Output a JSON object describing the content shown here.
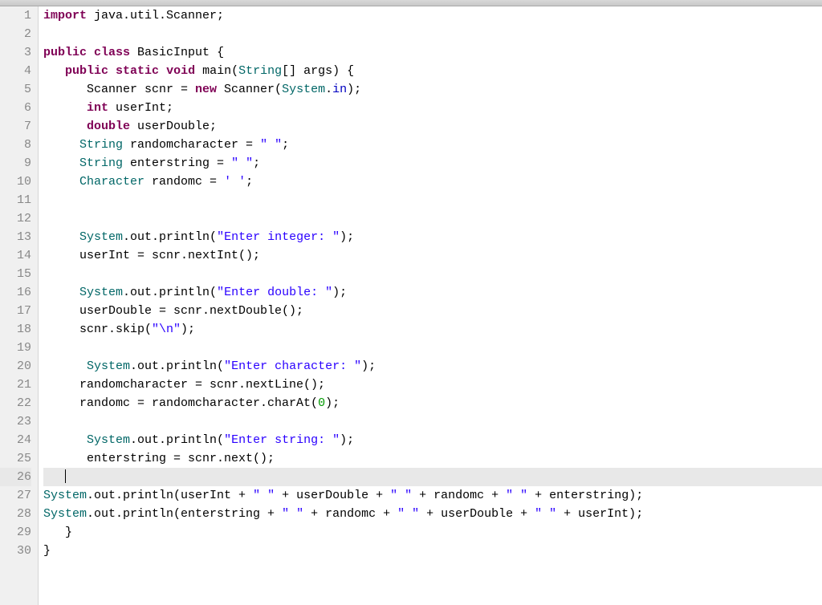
{
  "editor": {
    "current_line": 26,
    "lines": [
      {
        "num": 1,
        "tokens": [
          [
            "kw",
            "import"
          ],
          [
            "plain",
            " java.util.Scanner;"
          ]
        ]
      },
      {
        "num": 2,
        "tokens": [
          [
            "plain",
            ""
          ]
        ]
      },
      {
        "num": 3,
        "tokens": [
          [
            "kw",
            "public"
          ],
          [
            "plain",
            " "
          ],
          [
            "kw",
            "class"
          ],
          [
            "plain",
            " BasicInput {"
          ]
        ]
      },
      {
        "num": 4,
        "tokens": [
          [
            "plain",
            "   "
          ],
          [
            "kw",
            "public"
          ],
          [
            "plain",
            " "
          ],
          [
            "kw",
            "static"
          ],
          [
            "plain",
            " "
          ],
          [
            "kw",
            "void"
          ],
          [
            "plain",
            " main("
          ],
          [
            "type",
            "String"
          ],
          [
            "plain",
            "[] args) {"
          ]
        ]
      },
      {
        "num": 5,
        "tokens": [
          [
            "plain",
            "      Scanner scnr = "
          ],
          [
            "kw",
            "new"
          ],
          [
            "plain",
            " Scanner("
          ],
          [
            "type",
            "System"
          ],
          [
            "plain",
            "."
          ],
          [
            "fld",
            "in"
          ],
          [
            "plain",
            ");"
          ]
        ]
      },
      {
        "num": 6,
        "tokens": [
          [
            "plain",
            "      "
          ],
          [
            "kw",
            "int"
          ],
          [
            "plain",
            " userInt;"
          ]
        ]
      },
      {
        "num": 7,
        "tokens": [
          [
            "plain",
            "      "
          ],
          [
            "kw",
            "double"
          ],
          [
            "plain",
            " userDouble;"
          ]
        ]
      },
      {
        "num": 8,
        "tokens": [
          [
            "plain",
            "     "
          ],
          [
            "type",
            "String"
          ],
          [
            "plain",
            " randomcharacter = "
          ],
          [
            "str",
            "\" \""
          ],
          [
            "plain",
            ";"
          ]
        ]
      },
      {
        "num": 9,
        "tokens": [
          [
            "plain",
            "     "
          ],
          [
            "type",
            "String"
          ],
          [
            "plain",
            " enterstring = "
          ],
          [
            "str",
            "\" \""
          ],
          [
            "plain",
            ";"
          ]
        ]
      },
      {
        "num": 10,
        "tokens": [
          [
            "plain",
            "     "
          ],
          [
            "type",
            "Character"
          ],
          [
            "plain",
            " randomc = "
          ],
          [
            "str",
            "' '"
          ],
          [
            "plain",
            ";"
          ]
        ]
      },
      {
        "num": 11,
        "tokens": [
          [
            "plain",
            ""
          ]
        ]
      },
      {
        "num": 12,
        "tokens": [
          [
            "plain",
            ""
          ]
        ]
      },
      {
        "num": 13,
        "tokens": [
          [
            "plain",
            "     "
          ],
          [
            "type",
            "System"
          ],
          [
            "plain",
            ".out.println("
          ],
          [
            "str",
            "\"Enter integer: \""
          ],
          [
            "plain",
            ");"
          ]
        ]
      },
      {
        "num": 14,
        "tokens": [
          [
            "plain",
            "     userInt = scnr.nextInt();"
          ]
        ]
      },
      {
        "num": 15,
        "tokens": [
          [
            "plain",
            ""
          ]
        ]
      },
      {
        "num": 16,
        "tokens": [
          [
            "plain",
            "     "
          ],
          [
            "type",
            "System"
          ],
          [
            "plain",
            ".out.println("
          ],
          [
            "str",
            "\"Enter double: \""
          ],
          [
            "plain",
            ");"
          ]
        ]
      },
      {
        "num": 17,
        "tokens": [
          [
            "plain",
            "     userDouble = scnr.nextDouble();"
          ]
        ]
      },
      {
        "num": 18,
        "tokens": [
          [
            "plain",
            "     scnr.skip("
          ],
          [
            "str",
            "\"\\n\""
          ],
          [
            "plain",
            ");"
          ]
        ]
      },
      {
        "num": 19,
        "tokens": [
          [
            "plain",
            ""
          ]
        ]
      },
      {
        "num": 20,
        "tokens": [
          [
            "plain",
            "      "
          ],
          [
            "type",
            "System"
          ],
          [
            "plain",
            ".out.println("
          ],
          [
            "str",
            "\"Enter character: \""
          ],
          [
            "plain",
            ");"
          ]
        ]
      },
      {
        "num": 21,
        "tokens": [
          [
            "plain",
            "     randomcharacter = scnr.nextLine();"
          ]
        ]
      },
      {
        "num": 22,
        "tokens": [
          [
            "plain",
            "     randomc = randomcharacter.charAt("
          ],
          [
            "num",
            "0"
          ],
          [
            "plain",
            ");"
          ]
        ]
      },
      {
        "num": 23,
        "tokens": [
          [
            "plain",
            ""
          ]
        ]
      },
      {
        "num": 24,
        "tokens": [
          [
            "plain",
            "      "
          ],
          [
            "type",
            "System"
          ],
          [
            "plain",
            ".out.println("
          ],
          [
            "str",
            "\"Enter string: \""
          ],
          [
            "plain",
            ");"
          ]
        ]
      },
      {
        "num": 25,
        "tokens": [
          [
            "plain",
            "      enterstring = scnr.next();"
          ]
        ]
      },
      {
        "num": 26,
        "tokens": [
          [
            "plain",
            "   "
          ]
        ],
        "current": true
      },
      {
        "num": 27,
        "tokens": [
          [
            "type",
            "System"
          ],
          [
            "plain",
            ".out.println(userInt + "
          ],
          [
            "str",
            "\" \""
          ],
          [
            "plain",
            " + userDouble + "
          ],
          [
            "str",
            "\" \""
          ],
          [
            "plain",
            " + randomc + "
          ],
          [
            "str",
            "\" \""
          ],
          [
            "plain",
            " + enterstring);"
          ]
        ]
      },
      {
        "num": 28,
        "tokens": [
          [
            "type",
            "System"
          ],
          [
            "plain",
            ".out.println(enterstring + "
          ],
          [
            "str",
            "\" \""
          ],
          [
            "plain",
            " + randomc + "
          ],
          [
            "str",
            "\" \""
          ],
          [
            "plain",
            " + userDouble + "
          ],
          [
            "str",
            "\" \""
          ],
          [
            "plain",
            " + userInt);"
          ]
        ]
      },
      {
        "num": 29,
        "tokens": [
          [
            "plain",
            "   }"
          ]
        ]
      },
      {
        "num": 30,
        "tokens": [
          [
            "plain",
            "}"
          ]
        ]
      }
    ]
  }
}
